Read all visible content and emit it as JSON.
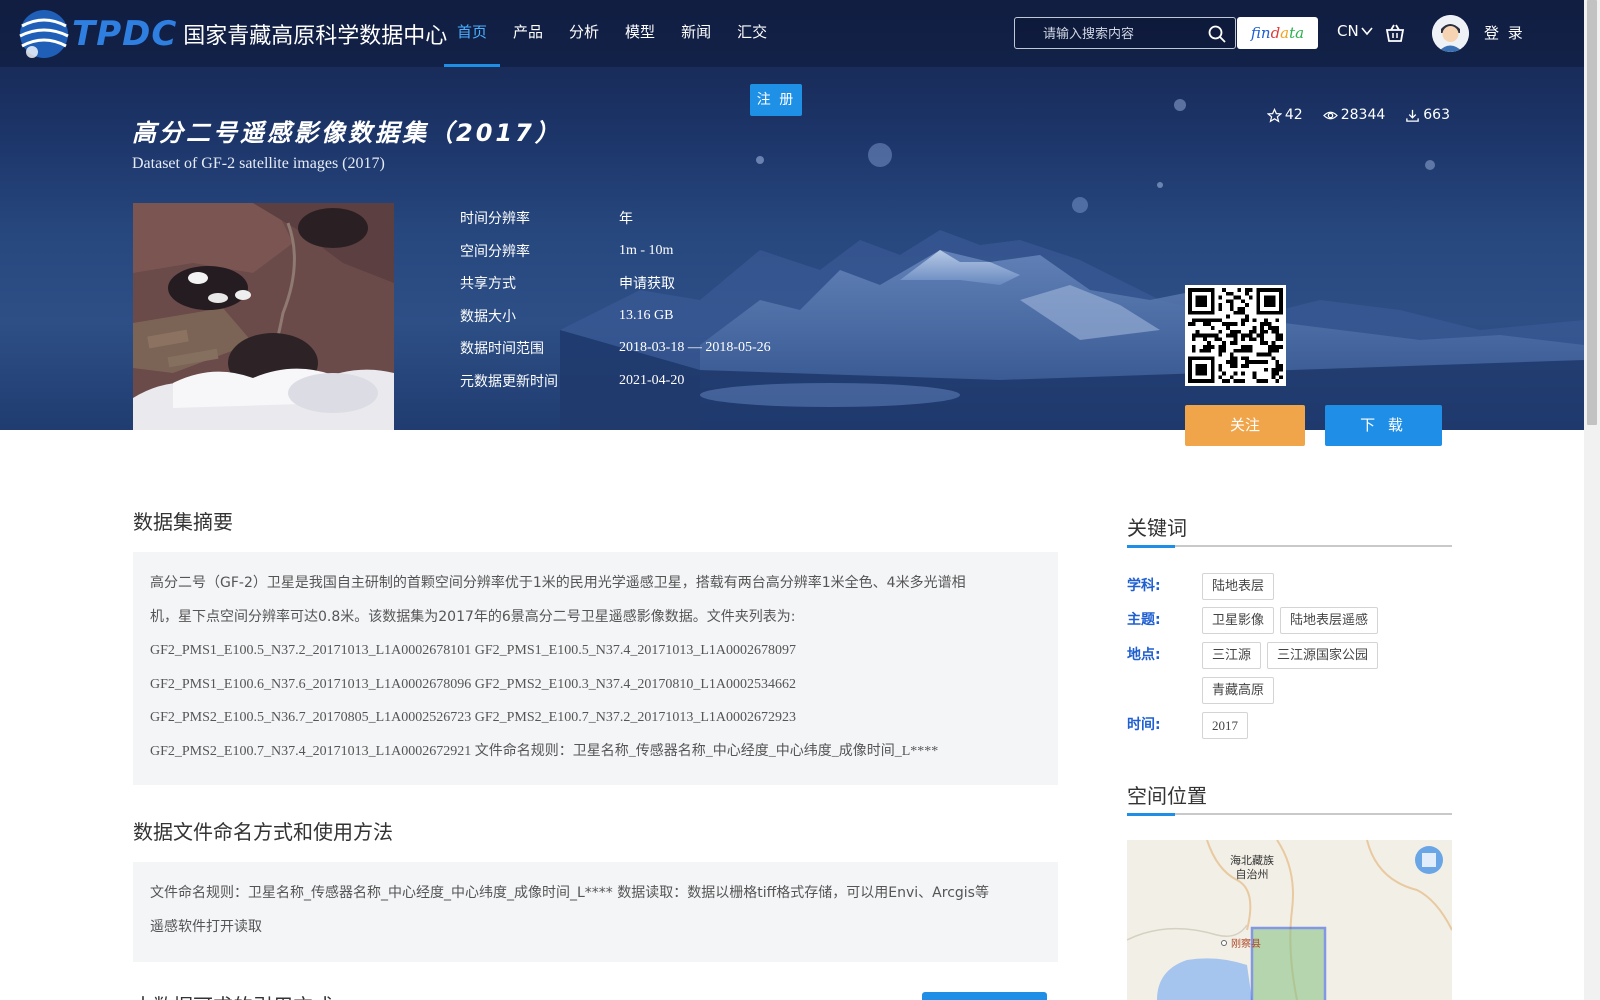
{
  "header": {
    "logo_text": "TPDC",
    "logo_cn": "国家青藏高原科学数据中心",
    "nav": [
      "首页",
      "产品",
      "分析",
      "模型",
      "新闻",
      "汇交"
    ],
    "search_placeholder": "请输入搜索内容",
    "findata": [
      "fin",
      "d",
      "a",
      "ta"
    ],
    "lang": "CN",
    "login": "登 录",
    "register": "注 册"
  },
  "dataset": {
    "title_cn": "高分二号遥感影像数据集（2017）",
    "title_en": "Dataset of GF-2 satellite images (2017)",
    "stats": {
      "stars": "42",
      "views": "28344",
      "downloads": "663"
    },
    "meta": [
      {
        "key": "时间分辨率",
        "value": "年"
      },
      {
        "key": "空间分辨率",
        "value": "1m - 10m"
      },
      {
        "key": "共享方式",
        "value": "申请获取"
      },
      {
        "key": "数据大小",
        "value": "13.16 GB"
      },
      {
        "key": "数据时间范围",
        "value": "2018-03-18 — 2018-05-26"
      },
      {
        "key": "元数据更新时间",
        "value": "2021-04-20"
      }
    ],
    "follow": "关注",
    "download": "下 载"
  },
  "abstract": {
    "title": "数据集摘要",
    "lines": [
      "高分二号（GF-2）卫星是我国自主研制的首颗空间分辨率优于1米的民用光学遥感卫星，搭载有两台高分辨率1米全色、4米多光谱相",
      "机，星下点空间分辨率可达0.8米。该数据集为2017年的6景高分二号卫星遥感影像数据。文件夹列表为:",
      "GF2_PMS1_E100.5_N37.2_20171013_L1A0002678101 GF2_PMS1_E100.5_N37.4_20171013_L1A0002678097",
      "GF2_PMS1_E100.6_N37.6_20171013_L1A0002678096 GF2_PMS2_E100.3_N37.4_20170810_L1A0002534662",
      "GF2_PMS2_E100.5_N36.7_20170805_L1A0002526723 GF2_PMS2_E100.7_N37.2_20171013_L1A0002672923",
      "GF2_PMS2_E100.7_N37.4_20171013_L1A0002672921 文件命名规则：卫星名称_传感器名称_中心经度_中心纬度_成像时间_L****"
    ]
  },
  "naming": {
    "title": "数据文件命名方式和使用方法",
    "lines": [
      "文件命名规则：卫星名称_传感器名称_中心经度_中心纬度_成像时间_L**** 数据读取：数据以栅格tiff格式存储，可以用Envi、Arcgis等",
      "遥感软件打开读取"
    ]
  },
  "partial_title": "本数据可求的引用方式",
  "keywords": {
    "title": "关键词",
    "rows": [
      {
        "label": "学科:",
        "tags": [
          "陆地表层"
        ]
      },
      {
        "label": "主题:",
        "tags": [
          "卫星影像",
          "陆地表层遥感"
        ]
      },
      {
        "label": "地点:",
        "tags": [
          "三江源",
          "三江源国家公园",
          "青藏高原"
        ]
      },
      {
        "label": "时间:",
        "tags": [
          "2017"
        ]
      }
    ]
  },
  "location": {
    "title": "空间位置",
    "map_labels": {
      "region": "海北藏族",
      "region2": "自治州",
      "county": "刚察县"
    }
  }
}
